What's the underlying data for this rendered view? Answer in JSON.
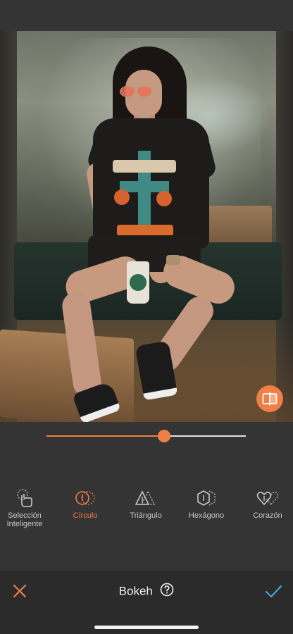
{
  "slider": {
    "value": 0.59
  },
  "tools": [
    {
      "label": "Selección\nInteligente",
      "icon": "smart-select-icon",
      "active": false
    },
    {
      "label": "Círculo",
      "icon": "circle-icon",
      "active": true
    },
    {
      "label": "Triángulo",
      "icon": "triangle-icon",
      "active": false
    },
    {
      "label": "Hexágono",
      "icon": "hexagon-icon",
      "active": false
    },
    {
      "label": "Corazón",
      "icon": "heart-icon",
      "active": false
    }
  ],
  "bottom": {
    "title": "Bokeh",
    "help_icon": "question-circle-icon",
    "cancel_icon": "close-icon",
    "confirm_icon": "checkmark-icon"
  },
  "compare_icon": "split-compare-icon",
  "colors": {
    "accent": "#ef7f45",
    "confirm": "#4aa3df",
    "background": "#343434"
  }
}
